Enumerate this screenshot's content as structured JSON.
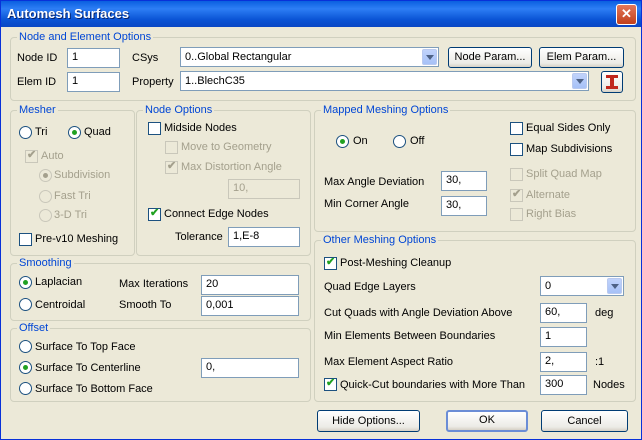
{
  "window": {
    "title": "Automesh Surfaces",
    "close": "✕"
  },
  "node_elem": {
    "group": "Node and Element Options",
    "node_id_label": "Node ID",
    "node_id": "1",
    "csys_label": "CSys",
    "csys": "0..Global Rectangular",
    "node_param": "Node Param...",
    "elem_param": "Elem Param...",
    "elem_id_label": "Elem ID",
    "elem_id": "1",
    "property_label": "Property",
    "property": "1..BlechC35"
  },
  "mesher": {
    "group": "Mesher",
    "tri": "Tri",
    "quad": "Quad",
    "auto": "Auto",
    "subdivision": "Subdivision",
    "fast_tri": "Fast Tri",
    "tri3d": "3-D Tri",
    "prev10": "Pre-v10 Meshing"
  },
  "node_options": {
    "group": "Node Options",
    "midside": "Midside Nodes",
    "move_geo": "Move to Geometry",
    "max_distortion": "Max Distortion Angle",
    "distortion_value": "10,",
    "connect_edge": "Connect Edge Nodes",
    "tolerance_label": "Tolerance",
    "tolerance": "1,E-8"
  },
  "mapped": {
    "group": "Mapped Meshing Options",
    "on": "On",
    "off": "Off",
    "equal_sides": "Equal Sides Only",
    "map_subdivisions": "Map Subdivisions",
    "split_quad": "Split Quad Map",
    "alternate": "Alternate",
    "right_bias": "Right Bias",
    "max_angle_label": "Max Angle Deviation",
    "max_angle": "30,",
    "min_corner_label": "Min Corner Angle",
    "min_corner": "30,"
  },
  "smoothing": {
    "group": "Smoothing",
    "laplacian": "Laplacian",
    "centroidal": "Centroidal",
    "max_iter_label": "Max Iterations",
    "max_iter": "20",
    "smooth_to_label": "Smooth To",
    "smooth_to": "0,001"
  },
  "offset": {
    "group": "Offset",
    "top": "Surface To Top Face",
    "center": "Surface To Centerline",
    "center_value": "0,",
    "bottom": "Surface To Bottom Face"
  },
  "other": {
    "group": "Other Meshing Options",
    "cleanup": "Post-Meshing Cleanup",
    "quad_layers_label": "Quad Edge Layers",
    "quad_layers": "0",
    "cut_quads_label": "Cut Quads with Angle Deviation Above",
    "cut_quads": "60,",
    "cut_quads_unit": "deg",
    "min_between_label": "Min Elements Between Boundaries",
    "min_between": "1",
    "aspect_label": "Max Element Aspect Ratio",
    "aspect": "2,",
    "aspect_unit": ":1",
    "quick_cut_label": "Quick-Cut boundaries with More Than",
    "quick_cut": "300",
    "quick_cut_unit": "Nodes"
  },
  "buttons": {
    "hide": "Hide Options...",
    "ok": "OK",
    "cancel": "Cancel"
  }
}
